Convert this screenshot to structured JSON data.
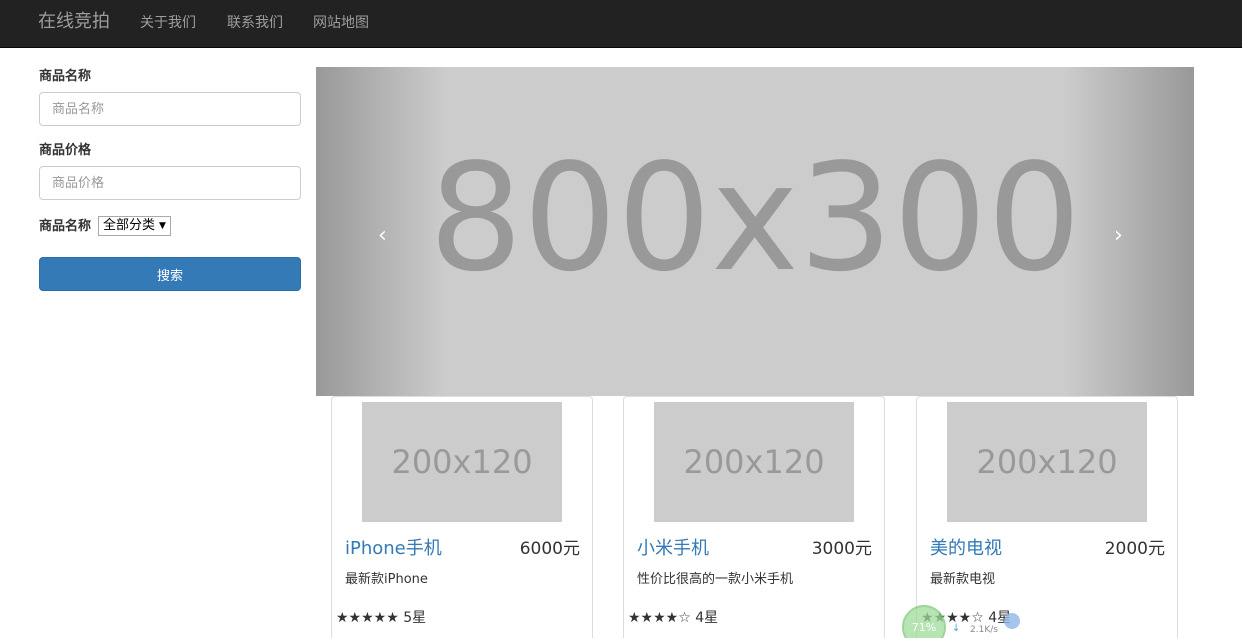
{
  "navbar": {
    "brand": "在线竞拍",
    "links": [
      "关于我们",
      "联系我们",
      "网站地图"
    ]
  },
  "search_form": {
    "name_label": "商品名称",
    "name_placeholder": "商品名称",
    "price_label": "商品价格",
    "price_placeholder": "商品价格",
    "category_label": "商品名称",
    "category_selected": "全部分类",
    "search_button": "搜索"
  },
  "carousel": {
    "placeholder_text": "800x300",
    "prev_icon": "‹",
    "next_icon": "›"
  },
  "products": [
    {
      "image_text": "200x120",
      "title": "iPhone手机",
      "price": "6000元",
      "description": "最新款iPhone",
      "stars": "★★★★★",
      "rating": "5星"
    },
    {
      "image_text": "200x120",
      "title": "小米手机",
      "price": "3000元",
      "description": "性价比很高的一款小米手机",
      "stars": "★★★★☆",
      "rating": "4星"
    },
    {
      "image_text": "200x120",
      "title": "美的电视",
      "price": "2000元",
      "description": "最新款电视",
      "stars": "★★★★☆",
      "rating": "4星"
    }
  ],
  "speed_widget": {
    "percent": "71%",
    "rate": "2.1K/s"
  },
  "colors": {
    "navbar_bg": "#222222",
    "primary": "#337ab7",
    "placeholder_bg": "#cccccc"
  }
}
